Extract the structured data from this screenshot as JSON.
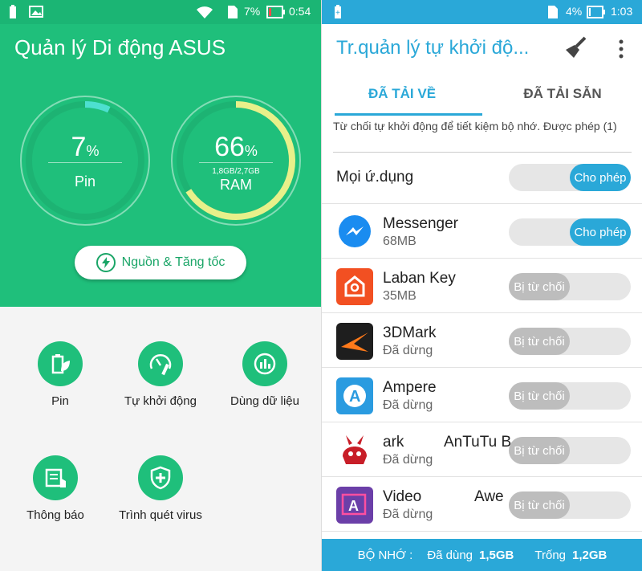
{
  "left": {
    "status": {
      "battery": "7%",
      "time": "0:54"
    },
    "title": "Quản lý Di động ASUS",
    "battery_gauge": {
      "value": "7",
      "unit": "%",
      "label": "Pin",
      "level": 0.07
    },
    "ram_gauge": {
      "value": "66",
      "unit": "%",
      "detail": "1,8GB/2,7GB",
      "label": "RAM",
      "level": 0.66
    },
    "boost_label": "Nguồn & Tăng tốc",
    "tiles": [
      {
        "label": "Pin",
        "icon": "battery-leaf-icon"
      },
      {
        "label": "Tự khởi động",
        "icon": "speedometer-wrench-icon"
      },
      {
        "label": "Dùng dữ liệu",
        "icon": "data-chart-icon"
      },
      {
        "label": "Thông báo",
        "icon": "notification-hand-icon"
      },
      {
        "label": "Trình quét virus",
        "icon": "shield-plus-icon"
      }
    ],
    "colors": {
      "accent": "#1fbf7b",
      "gauge_battery": "#4de0d0",
      "gauge_ram": "#e8f08a"
    }
  },
  "right": {
    "status": {
      "battery": "4%",
      "time": "1:03"
    },
    "title": "Tr.quản lý tự khởi độ...",
    "tabs": [
      "ĐÃ TẢI VỀ",
      "ĐÃ TẢI SẴN"
    ],
    "description": "Từ chối tự khởi động để tiết kiệm bộ nhớ. Được phép (1)",
    "all_apps": {
      "label": "Mọi ứ.dụng",
      "state": "Cho phép"
    },
    "apps": [
      {
        "name": "Messenger",
        "sub": "68MB",
        "state": "Cho phép"
      },
      {
        "name": "Laban Key",
        "sub": "35MB",
        "state": "Bị từ chối"
      },
      {
        "name": "3DMark",
        "sub": "Đã dừng",
        "state": "Bị từ chối"
      },
      {
        "name": "Ampere",
        "sub": "Đã dừng",
        "state": "Bị từ chối"
      },
      {
        "name": "ark",
        "name2": "AnTuTu B",
        "sub": "Đã dừng",
        "state": "Bị từ chối"
      },
      {
        "name": "Video",
        "name2": "Awe",
        "sub": "Đã dừng",
        "state": "Bị từ chối"
      }
    ],
    "footer": {
      "label": "BỘ NHỚ :",
      "used_label": "Đã dùng",
      "used": "1,5GB",
      "free_label": "Trống",
      "free": "1,2GB"
    },
    "colors": {
      "accent": "#2aa8d8"
    }
  }
}
